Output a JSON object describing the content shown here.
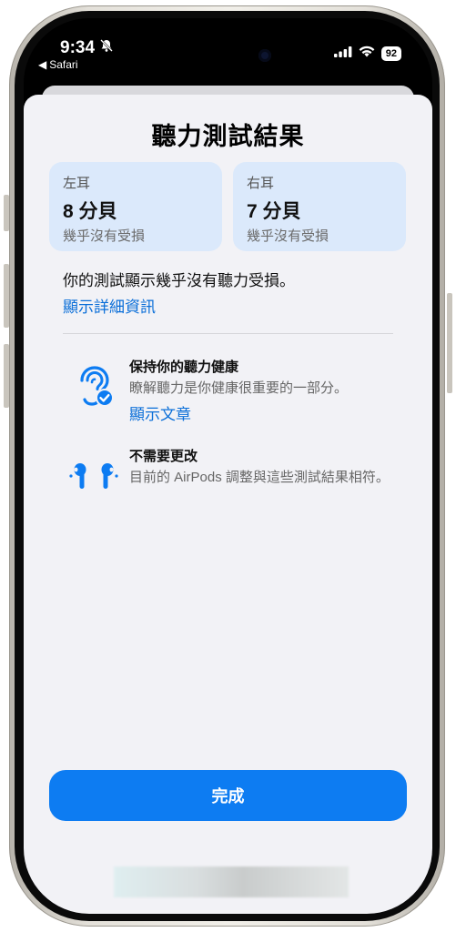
{
  "status_bar": {
    "time": "9:34",
    "back_app": "Safari",
    "battery": "92"
  },
  "page": {
    "title": "聽力測試結果"
  },
  "left_ear": {
    "label": "左耳",
    "value": "8 分貝",
    "status": "幾乎沒有受損"
  },
  "right_ear": {
    "label": "右耳",
    "value": "7 分貝",
    "status": "幾乎沒有受損"
  },
  "summary": {
    "text": "你的測試顯示幾乎沒有聽力受損。",
    "details_link": "顯示詳細資訊"
  },
  "rows": [
    {
      "icon": "ear-check-icon",
      "title": "保持你的聽力健康",
      "description": "瞭解聽力是你健康很重要的一部分。",
      "link": "顯示文章"
    },
    {
      "icon": "airpods-icon",
      "title": "不需要更改",
      "description": "目前的 AirPods 調整與這些測試結果相符。"
    }
  ],
  "actions": {
    "done_label": "完成"
  },
  "colors": {
    "accent": "#0d7cf2",
    "link": "#0a6ed8",
    "card_bg": "#dbe9fb",
    "sheet_bg": "#f2f2f6"
  }
}
